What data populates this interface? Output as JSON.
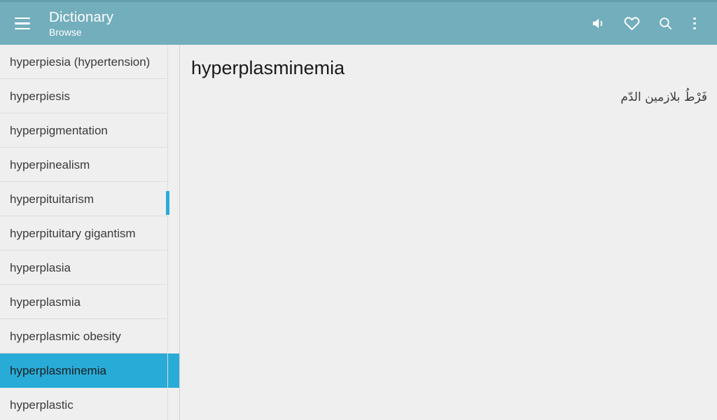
{
  "app": {
    "title": "Dictionary",
    "subtitle": "Browse"
  },
  "colors": {
    "appbar": "#73aebc",
    "status_strip": "#63a0ae",
    "accent": "#29abd8",
    "panel_bg": "#efefef",
    "divider": "#dddddd",
    "text": "#3b3b3b"
  },
  "appbar": {
    "menu_icon": "hamburger-menu-icon",
    "actions": [
      {
        "name": "speaker-icon",
        "label": "Pronounce"
      },
      {
        "name": "heart-icon",
        "label": "Favorite"
      },
      {
        "name": "search-icon",
        "label": "Search"
      },
      {
        "name": "overflow-menu-icon",
        "label": "More options"
      }
    ]
  },
  "sidebar": {
    "selected_index": 9,
    "items": [
      {
        "label": "hyperpiesia (hypertension)"
      },
      {
        "label": "hyperpiesis"
      },
      {
        "label": "hyperpigmentation"
      },
      {
        "label": "hyperpinealism"
      },
      {
        "label": "hyperpituitarism"
      },
      {
        "label": "hyperpituitary gigantism"
      },
      {
        "label": "hyperplasia"
      },
      {
        "label": "hyperplasmia"
      },
      {
        "label": "hyperplasmic obesity"
      },
      {
        "label": "hyperplasminemia"
      },
      {
        "label": "hyperplastic"
      }
    ]
  },
  "entry": {
    "headword": "hyperplasminemia",
    "translation": "فَرْطُ بلازمين الدّم"
  }
}
